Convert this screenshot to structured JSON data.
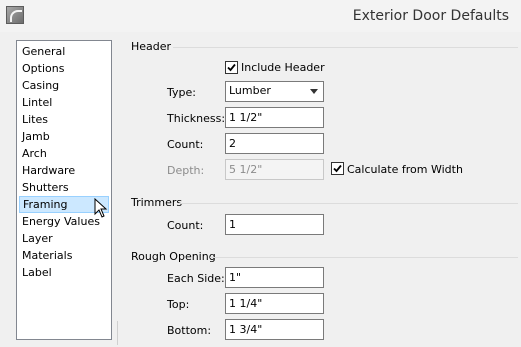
{
  "window": {
    "title": "Exterior Door Defaults",
    "icon": "app-icon"
  },
  "nav": {
    "items": [
      {
        "label": "General"
      },
      {
        "label": "Options"
      },
      {
        "label": "Casing"
      },
      {
        "label": "Lintel"
      },
      {
        "label": "Lites"
      },
      {
        "label": "Jamb"
      },
      {
        "label": "Arch"
      },
      {
        "label": "Hardware"
      },
      {
        "label": "Shutters"
      },
      {
        "label": "Framing"
      },
      {
        "label": "Energy Values"
      },
      {
        "label": "Layer"
      },
      {
        "label": "Materials"
      },
      {
        "label": "Label"
      }
    ],
    "selected": "Framing"
  },
  "header": {
    "group_label": "Header",
    "include_header_label": "Include Header",
    "include_header_checked": true,
    "type_label": "Type:",
    "type_value": "Lumber",
    "thickness_label": "Thickness:",
    "thickness_value": "1 1/2\"",
    "count_label": "Count:",
    "count_value": "2",
    "depth_label": "Depth:",
    "depth_value": "5 1/2\"",
    "calculate_label": "Calculate from Width",
    "calculate_checked": true
  },
  "trimmers": {
    "group_label": "Trimmers",
    "count_label": "Count:",
    "count_value": "1"
  },
  "rough_opening": {
    "group_label": "Rough Opening",
    "each_side_label": "Each Side:",
    "each_side_value": "1\"",
    "top_label": "Top:",
    "top_value": "1 1/4\"",
    "bottom_label": "Bottom:",
    "bottom_value": "1 3/4\""
  }
}
